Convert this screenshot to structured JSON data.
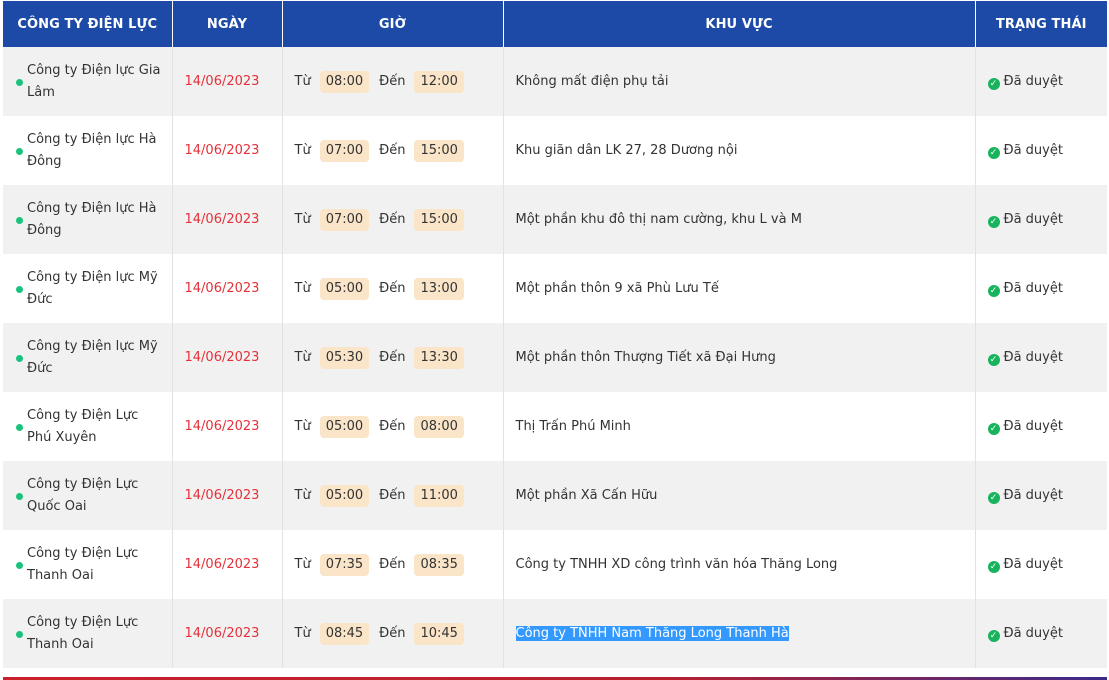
{
  "headers": {
    "company": "CÔNG TY ĐIỆN LỰC",
    "date": "NGÀY",
    "time": "GIỜ",
    "area": "KHU VỰC",
    "status": "TRẠNG THÁI"
  },
  "labels": {
    "from": "Từ",
    "to": "Đến"
  },
  "colors": {
    "header_bg": "#1d4aa6",
    "date_text": "#e4313a",
    "time_pill": "#fae5c9",
    "status_ok": "#19b35e",
    "dot": "#19c37d"
  },
  "rows": [
    {
      "company": "Công ty Điện lực Gia Lâm",
      "date": "14/06/2023",
      "start": "08:00",
      "end": "12:00",
      "area": "Không mất điện phụ tải",
      "status": "Đã duyệt"
    },
    {
      "company": "Công ty Điện lực Hà Đông",
      "date": "14/06/2023",
      "start": "07:00",
      "end": "15:00",
      "area": "Khu giãn dân LK 27, 28 Dương nội",
      "status": "Đã duyệt"
    },
    {
      "company": "Công ty Điện lực Hà Đông",
      "date": "14/06/2023",
      "start": "07:00",
      "end": "15:00",
      "area": "Một phần khu đô thị nam cường, khu L và M",
      "status": "Đã duyệt"
    },
    {
      "company": "Công ty Điện lực Mỹ Đức",
      "date": "14/06/2023",
      "start": "05:00",
      "end": "13:00",
      "area": "Một phần thôn 9 xã Phù Lưu Tế",
      "status": "Đã duyệt"
    },
    {
      "company": "Công ty Điện lực Mỹ Đức",
      "date": "14/06/2023",
      "start": "05:30",
      "end": "13:30",
      "area": "Một phần thôn Thượng Tiết xã Đại Hưng",
      "status": "Đã duyệt"
    },
    {
      "company": "Công ty Điện Lực Phú Xuyên",
      "date": "14/06/2023",
      "start": "05:00",
      "end": "08:00",
      "area": "Thị Trấn Phú Minh",
      "status": "Đã duyệt"
    },
    {
      "company": "Công ty Điện Lực Quốc Oai",
      "date": "14/06/2023",
      "start": "05:00",
      "end": "11:00",
      "area": "Một phần Xã Cấn Hữu",
      "status": "Đã duyệt"
    },
    {
      "company": "Công ty Điện Lực Thanh Oai",
      "date": "14/06/2023",
      "start": "07:35",
      "end": "08:35",
      "area": "Công ty TNHH XD công trình văn hóa Thăng Long",
      "status": "Đã duyệt"
    },
    {
      "company": "Công ty Điện Lực Thanh Oai",
      "date": "14/06/2023",
      "start": "08:45",
      "end": "10:45",
      "area": "Công ty TNHH Nam Thăng Long Thanh Hà",
      "status": "Đã duyệt",
      "selected": true
    }
  ]
}
